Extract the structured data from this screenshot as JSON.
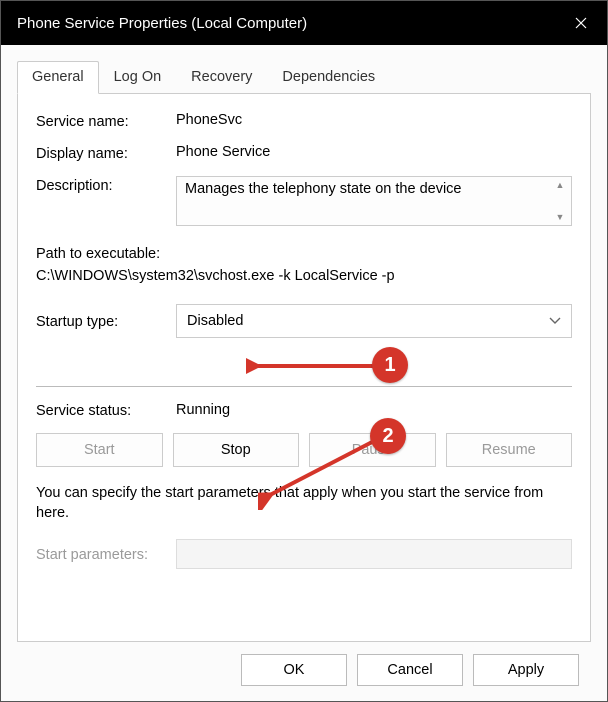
{
  "window": {
    "title": "Phone Service Properties (Local Computer)"
  },
  "tabs": {
    "general": "General",
    "logon": "Log On",
    "recovery": "Recovery",
    "dependencies": "Dependencies"
  },
  "labels": {
    "service_name": "Service name:",
    "display_name": "Display name:",
    "description": "Description:",
    "path_label": "Path to executable:",
    "startup_type": "Startup type:",
    "service_status": "Service status:",
    "start_parameters": "Start parameters:"
  },
  "values": {
    "service_name": "PhoneSvc",
    "display_name": "Phone Service",
    "description": "Manages the telephony state on the device",
    "path": "C:\\WINDOWS\\system32\\svchost.exe -k LocalService -p",
    "startup_selected": "Disabled",
    "service_status": "Running"
  },
  "buttons": {
    "start": "Start",
    "stop": "Stop",
    "pause": "Pause",
    "resume": "Resume",
    "ok": "OK",
    "cancel": "Cancel",
    "apply": "Apply"
  },
  "note": "You can specify the start parameters that apply when you start the service from here.",
  "annotations": {
    "one": "1",
    "two": "2"
  }
}
